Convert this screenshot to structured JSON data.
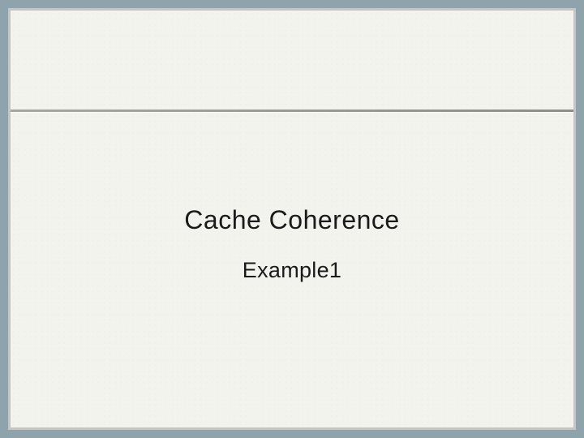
{
  "slide": {
    "title": "Cache Coherence",
    "subtitle": "Example1"
  }
}
